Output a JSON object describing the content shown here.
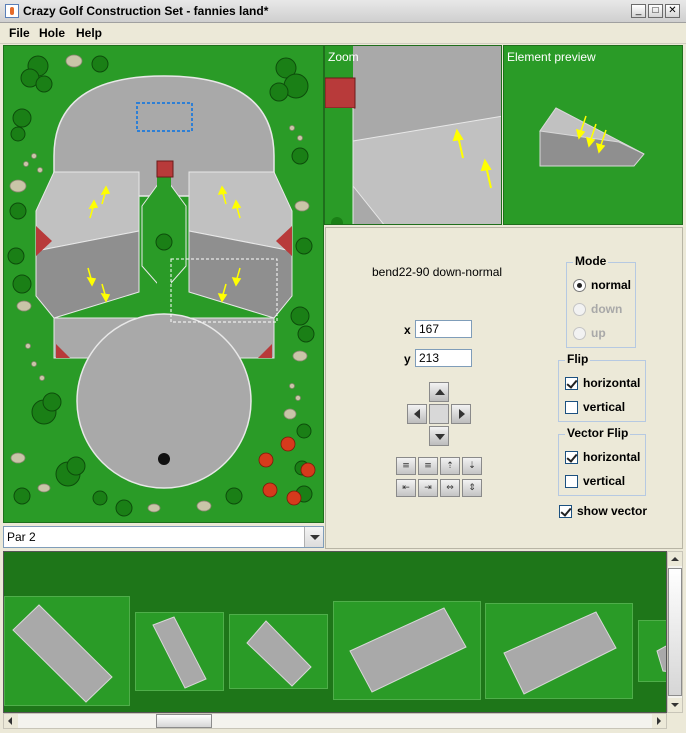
{
  "window": {
    "title": "Crazy Golf Construction Set - fannies land*",
    "minimize_glyph": "_",
    "maximize_glyph": "□",
    "close_glyph": "✕"
  },
  "menu": {
    "file": "File",
    "hole": "Hole",
    "help": "Help"
  },
  "course": {
    "par_value": "Par 2"
  },
  "zoom": {
    "label": "Zoom"
  },
  "preview": {
    "label": "Element preview"
  },
  "properties": {
    "element_name": "bend22-90 down-normal",
    "x_label": "x",
    "x_value": "167",
    "y_label": "y",
    "y_value": "213"
  },
  "mode": {
    "title": "Mode",
    "options": [
      {
        "label": "normal",
        "selected": true,
        "enabled": true
      },
      {
        "label": "down",
        "selected": false,
        "enabled": false
      },
      {
        "label": "up",
        "selected": false,
        "enabled": false
      }
    ]
  },
  "flip": {
    "title": "Flip",
    "horizontal_label": "horizontal",
    "horizontal_checked": true,
    "vertical_label": "vertical",
    "vertical_checked": false
  },
  "vector_flip": {
    "title": "Vector Flip",
    "horizontal_label": "horizontal",
    "horizontal_checked": true,
    "vertical_label": "vertical",
    "vertical_checked": false
  },
  "show_vector": {
    "label": "show vector",
    "checked": true
  },
  "align_tools": {
    "icons": [
      "align-top-icon",
      "align-middle-icon",
      "align-up-edge-icon",
      "align-down-edge-icon",
      "align-left-edge-icon",
      "align-right-edge-icon",
      "center-horizontal-icon",
      "center-vertical-icon"
    ],
    "glyphs": [
      "≡",
      "≡",
      "⇡",
      "⇣",
      "⇤",
      "⇥",
      "⇔",
      "⇕"
    ]
  },
  "colors": {
    "grass": "#2a9b27",
    "dark_grass": "#1e7619",
    "path": "#a9a9a9",
    "path_light": "#c0c0c0",
    "path_dark": "#8f8f8f",
    "brick": "#b83a3a",
    "arrow": "#ffff00",
    "selection": "#2d7fd6"
  }
}
